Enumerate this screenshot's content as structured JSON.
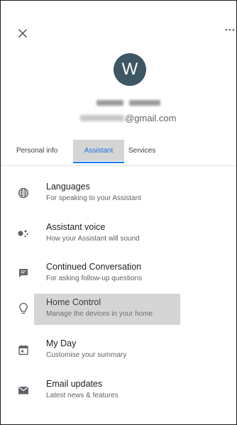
{
  "header": {
    "avatar_initial": "W",
    "email_suffix": "@gmail.com"
  },
  "tabs": [
    {
      "label": "Personal info"
    },
    {
      "label": "Assistant"
    },
    {
      "label": "Services"
    }
  ],
  "active_tab": "Assistant",
  "items": [
    {
      "title": "Languages",
      "subtitle": "For speaking to your Assistant",
      "icon": "globe-icon"
    },
    {
      "title": "Assistant voice",
      "subtitle": "How your Assistant will sound",
      "icon": "assistant-dots-icon"
    },
    {
      "title": "Continued Conversation",
      "subtitle": "For asking follow-up questions",
      "icon": "chat-icon"
    },
    {
      "title": "Home Control",
      "subtitle": "Manage the devices in your home",
      "icon": "lightbulb-icon"
    },
    {
      "title": "My Day",
      "subtitle": "Customise your summary",
      "icon": "calendar-icon"
    },
    {
      "title": "Email updates",
      "subtitle": "Latest news & features",
      "icon": "mail-icon"
    }
  ],
  "colors": {
    "accent": "#1a73e8",
    "avatar_bg": "#3d5764",
    "highlight_bg": "#d5d5d5"
  }
}
